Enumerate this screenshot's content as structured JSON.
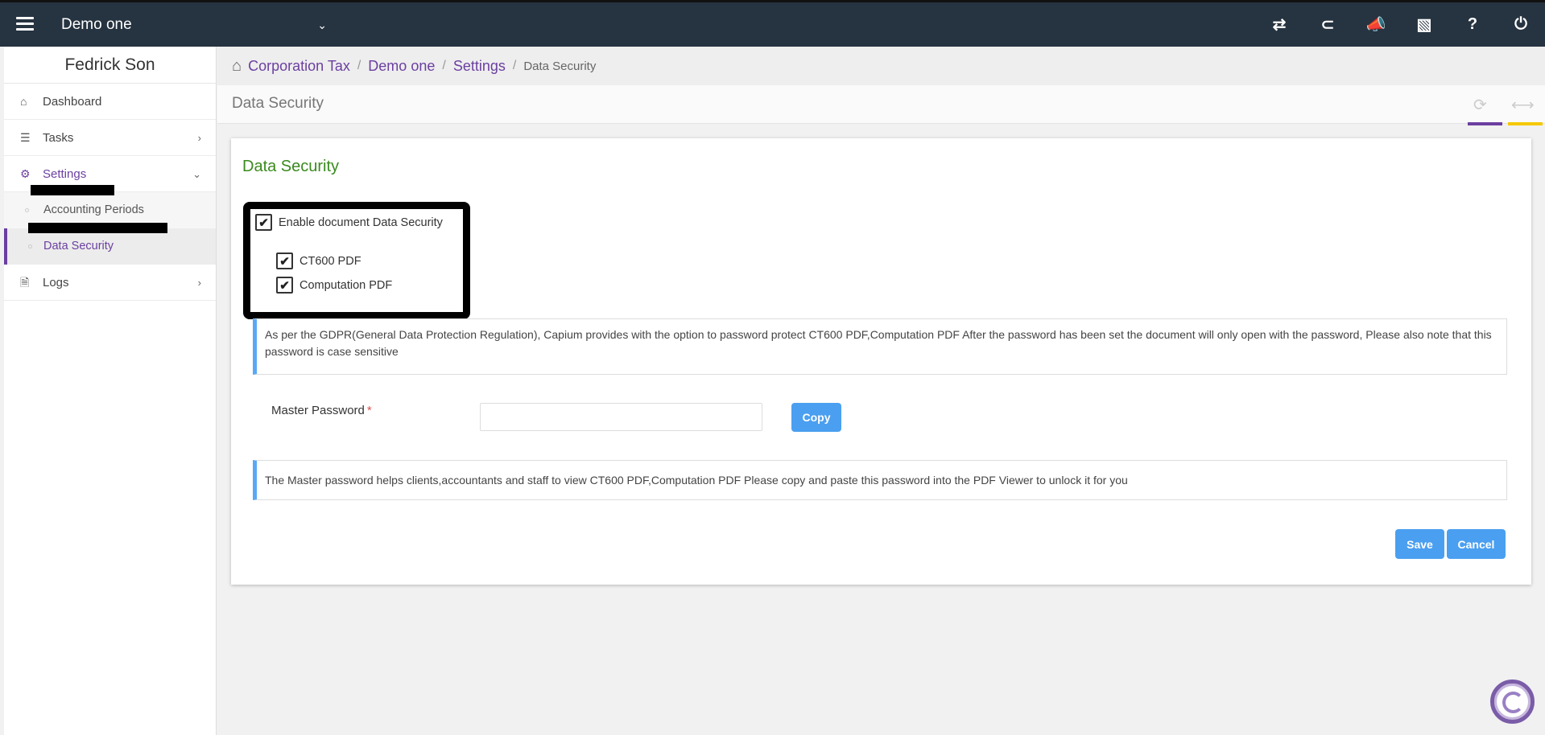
{
  "topbar": {
    "company": "Demo one",
    "icons": [
      "switch-icon",
      "capium-icon",
      "megaphone-icon",
      "ticket-icon",
      "help-icon",
      "power-icon"
    ]
  },
  "sidebar": {
    "user_name": "Fedrick Son",
    "items": [
      {
        "label": "Dashboard",
        "icon": "home-icon"
      },
      {
        "label": "Tasks",
        "icon": "tasks-icon"
      },
      {
        "label": "Settings",
        "icon": "gear-icon"
      },
      {
        "label": "Logs",
        "icon": "file-icon"
      }
    ],
    "settings_sub": [
      {
        "label": "Accounting Periods"
      },
      {
        "label": "Data Security"
      }
    ]
  },
  "breadcrumb": {
    "items": [
      "Corporation Tax",
      "Demo one",
      "Settings"
    ],
    "current": "Data Security",
    "separator": "/"
  },
  "page": {
    "title": "Data Security"
  },
  "card": {
    "title": "Data Security",
    "enable_label": "Enable document Data Security",
    "ct600_label": "CT600 PDF",
    "computation_label": "Computation PDF",
    "enable_checked": true,
    "ct600_checked": true,
    "computation_checked": true,
    "gdpr_info": "As per the GDPR(General Data Protection Regulation), Capium provides with the option to password protect CT600 PDF,Computation PDF After the password has been set the document will only open with the password, Please also note that this password is case sensitive",
    "master_password_label": "Master Password",
    "required_marker": "*",
    "master_password_value": "",
    "copy_label": "Copy",
    "master_info": "The Master password helps clients,accountants and staff to view CT600 PDF,Computation PDF Please copy and paste this password into the PDF Viewer to unlock it for you",
    "save_label": "Save",
    "cancel_label": "Cancel"
  },
  "colors": {
    "topbar": "#263340",
    "accent_purple": "#6b3fa0",
    "title_green": "#3a8a1e",
    "button_blue": "#4a9ff0",
    "header_bar_yellow": "#f5c800"
  }
}
